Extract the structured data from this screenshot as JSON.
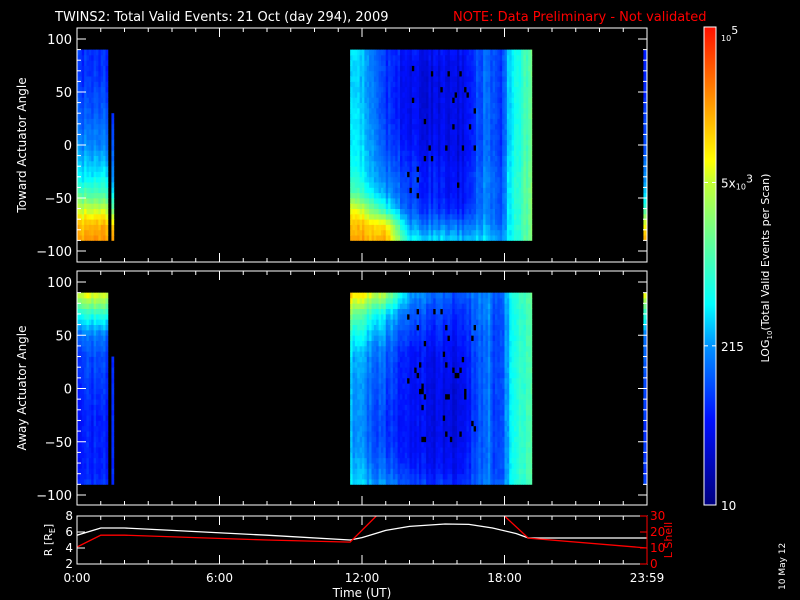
{
  "title": {
    "main": "TWINS2: Total Valid Events: 21 Oct (day 294), 2009",
    "note": "NOTE: Data Preliminary - Not validated",
    "note_color": "#ff0000"
  },
  "date_stamp": "10 May 12",
  "chart_data": [
    {
      "type": "heatmap",
      "name": "toward",
      "ylabel": "Toward Actuator Angle",
      "ylim": [
        -110,
        110
      ],
      "yticks": [
        "100",
        "50",
        "0",
        "−50",
        "−100"
      ],
      "ytick_values": [
        100,
        50,
        0,
        -50,
        -100
      ],
      "xlim_hours": [
        0,
        24
      ],
      "angle_range": [
        -90,
        90
      ],
      "segments": [
        [
          0,
          1.3,
          90
        ],
        [
          1.45,
          1.55,
          30
        ],
        [
          11.5,
          19.15,
          90
        ],
        [
          23.85,
          24,
          90
        ]
      ],
      "angles": [
        -90,
        -75,
        -60,
        -45,
        -30,
        0,
        30,
        50,
        70,
        90
      ],
      "log10_profiles": [
        {
          "t": 0,
          "v": [
            4.35,
            4.2,
            3.7,
            3.1,
            2.7,
            2.3,
            2.1,
            2.0,
            1.9,
            1.9
          ]
        },
        {
          "t": 1.3,
          "v": [
            4.35,
            4.2,
            3.6,
            3.0,
            2.6,
            2.2,
            2.0,
            1.9,
            1.8,
            1.8
          ]
        },
        {
          "t": 1.5,
          "v": [
            4.3,
            4.0,
            3.2,
            2.6,
            2.2,
            2.0,
            1.8,
            1.8,
            1.8,
            1.8
          ]
        },
        {
          "t": 11.5,
          "v": [
            4.3,
            4.2,
            3.9,
            3.2,
            2.9,
            2.7,
            2.7,
            2.6,
            2.6,
            2.7
          ]
        },
        {
          "t": 12.5,
          "v": [
            4.3,
            4.1,
            3.3,
            2.7,
            2.5,
            2.4,
            2.3,
            2.3,
            2.3,
            2.3
          ]
        },
        {
          "t": 13.0,
          "v": [
            4.3,
            4.0,
            2.8,
            2.4,
            2.2,
            2.0,
            1.9,
            1.9,
            1.9,
            1.9
          ]
        },
        {
          "t": 14.0,
          "v": [
            2.7,
            2.3,
            2.0,
            1.9,
            1.9,
            1.7,
            1.6,
            1.6,
            1.6,
            1.7
          ]
        },
        {
          "t": 16.0,
          "v": [
            2.5,
            2.1,
            1.7,
            1.6,
            1.6,
            1.5,
            1.5,
            1.5,
            1.5,
            1.6
          ]
        },
        {
          "t": 17.3,
          "v": [
            2.6,
            2.4,
            2.3,
            2.3,
            2.3,
            2.2,
            2.2,
            2.2,
            2.2,
            2.2
          ]
        },
        {
          "t": 17.8,
          "v": [
            2.3,
            2.0,
            1.9,
            1.9,
            1.9,
            1.8,
            1.8,
            1.8,
            1.8,
            1.8
          ]
        },
        {
          "t": 18.3,
          "v": [
            2.8,
            2.8,
            2.8,
            2.8,
            2.8,
            2.7,
            2.7,
            2.7,
            2.7,
            2.7
          ]
        },
        {
          "t": 19.15,
          "v": [
            3.3,
            3.3,
            3.3,
            3.3,
            3.3,
            3.2,
            3.2,
            3.2,
            3.2,
            3.2
          ]
        },
        {
          "t": 23.85,
          "v": [
            4.3,
            3.8,
            3.0,
            2.5,
            2.3,
            2.0,
            1.9,
            1.8,
            1.8,
            1.8
          ]
        }
      ]
    },
    {
      "type": "heatmap",
      "name": "away",
      "ylabel": "Away Actuator Angle",
      "ylim": [
        -110,
        110
      ],
      "yticks": [
        "100",
        "50",
        "0",
        "−50",
        "−100"
      ],
      "ytick_values": [
        100,
        50,
        0,
        -50,
        -100
      ],
      "xlim_hours": [
        0,
        24
      ],
      "angle_range": [
        -90,
        90
      ],
      "segments": [
        [
          0,
          1.3,
          90
        ],
        [
          1.45,
          1.55,
          30
        ],
        [
          11.5,
          19.15,
          90
        ],
        [
          23.85,
          24,
          90
        ]
      ],
      "angles": [
        -90,
        -75,
        -60,
        -45,
        -30,
        0,
        30,
        50,
        70,
        90
      ],
      "log10_profiles": [
        {
          "t": 0,
          "v": [
            1.9,
            1.8,
            1.8,
            1.8,
            1.8,
            1.9,
            2.0,
            2.2,
            2.9,
            3.9
          ]
        },
        {
          "t": 1.3,
          "v": [
            1.9,
            1.8,
            1.8,
            1.8,
            1.8,
            1.9,
            2.0,
            2.2,
            2.9,
            3.9
          ]
        },
        {
          "t": 1.5,
          "v": [
            1.8,
            1.8,
            1.8,
            1.8,
            1.8,
            1.8,
            1.8,
            1.8,
            1.8,
            1.8
          ]
        },
        {
          "t": 11.5,
          "v": [
            2.6,
            2.5,
            2.4,
            2.4,
            2.4,
            2.4,
            2.5,
            2.8,
            3.3,
            4.2
          ]
        },
        {
          "t": 13.0,
          "v": [
            2.3,
            2.1,
            2.0,
            1.9,
            1.9,
            2.0,
            2.1,
            2.3,
            2.6,
            3.6
          ]
        },
        {
          "t": 14.0,
          "v": [
            2.0,
            1.8,
            1.7,
            1.7,
            1.7,
            1.7,
            1.7,
            1.9,
            2.1,
            2.4
          ]
        },
        {
          "t": 16.0,
          "v": [
            1.8,
            1.6,
            1.6,
            1.5,
            1.5,
            1.5,
            1.6,
            1.7,
            1.8,
            2.0
          ]
        },
        {
          "t": 17.3,
          "v": [
            2.3,
            2.2,
            2.2,
            2.2,
            2.2,
            2.2,
            2.2,
            2.2,
            2.3,
            2.3
          ]
        },
        {
          "t": 17.8,
          "v": [
            1.9,
            1.8,
            1.8,
            1.8,
            1.8,
            1.8,
            1.8,
            1.8,
            1.8,
            1.9
          ]
        },
        {
          "t": 18.3,
          "v": [
            2.7,
            2.7,
            2.7,
            2.7,
            2.7,
            2.7,
            2.7,
            2.7,
            2.7,
            2.8
          ]
        },
        {
          "t": 19.15,
          "v": [
            3.2,
            3.2,
            3.2,
            3.2,
            3.2,
            3.2,
            3.2,
            3.2,
            3.2,
            3.3
          ]
        },
        {
          "t": 23.85,
          "v": [
            1.9,
            1.8,
            1.8,
            1.8,
            1.8,
            1.9,
            2.0,
            2.1,
            2.8,
            3.9
          ]
        }
      ]
    },
    {
      "type": "line",
      "name": "orbit",
      "xlabel": "Time (UT)",
      "xticks": [
        "0:00",
        "6:00",
        "12:00",
        "18:00",
        "23:59"
      ],
      "xtick_hours": [
        0,
        6,
        12,
        18,
        24
      ],
      "ylabel_left": "R [R",
      "ylabel_left_sub": "E",
      "ylabel_left_end": "]",
      "ylim_left": [
        2,
        8
      ],
      "yticks_left": [
        "8",
        "6",
        "4",
        "2"
      ],
      "ytick_left_values": [
        8,
        6,
        4,
        2
      ],
      "ylabel_right": "L Shell",
      "ylim_right": [
        0,
        30
      ],
      "yticks_right": [
        "30",
        "20",
        "10",
        "0"
      ],
      "ytick_right_values": [
        30,
        20,
        10,
        0
      ],
      "series": [
        {
          "name": "R",
          "color": "#ffffff",
          "points": [
            [
              0,
              5.6
            ],
            [
              1,
              6.5
            ],
            [
              2,
              6.5
            ],
            [
              4,
              6.2
            ],
            [
              8,
              5.6
            ],
            [
              11.5,
              5.0
            ],
            [
              12,
              5.3
            ],
            [
              13,
              6.2
            ],
            [
              14,
              6.7
            ],
            [
              15.5,
              7.0
            ],
            [
              16.5,
              6.95
            ],
            [
              17.5,
              6.5
            ],
            [
              18.5,
              5.8
            ],
            [
              19,
              5.25
            ],
            [
              24,
              5.25
            ]
          ]
        },
        {
          "name": "L Shell",
          "color": "#ff0000",
          "points": [
            [
              0,
              10.6
            ],
            [
              1,
              18
            ],
            [
              2,
              18
            ],
            [
              5,
              16.5
            ],
            [
              8,
              15
            ],
            [
              11.5,
              13.7
            ],
            [
              12.6,
              30
            ]
          ]
        },
        {
          "name": "L Shell (post)",
          "color": "#ff0000",
          "points": [
            [
              18.0,
              30
            ],
            [
              19,
              16.2
            ],
            [
              24,
              10
            ]
          ]
        }
      ]
    },
    {
      "type": "colorbar",
      "name": "colorbar",
      "label": "LOG",
      "label_sub": "10",
      "label_rest": "(Total Valid Events per Scan)",
      "log10_range": [
        1,
        5
      ],
      "ticks": [
        {
          "value": 5,
          "base": "10",
          "exp": "5",
          "prefix": ""
        },
        {
          "value": 3.699,
          "base": "10",
          "exp": "3",
          "prefix": "5x"
        },
        {
          "value": 2.332,
          "text": "215"
        },
        {
          "value": 1,
          "text": "10"
        }
      ],
      "colormap": [
        [
          0,
          "#00007f"
        ],
        [
          0.18,
          "#0010ff"
        ],
        [
          0.33,
          "#0090ff"
        ],
        [
          0.42,
          "#00ffff"
        ],
        [
          0.55,
          "#60ff98"
        ],
        [
          0.68,
          "#c8ff30"
        ],
        [
          0.72,
          "#ffff00"
        ],
        [
          0.85,
          "#ff9000"
        ],
        [
          1,
          "#ff1000"
        ]
      ]
    }
  ]
}
